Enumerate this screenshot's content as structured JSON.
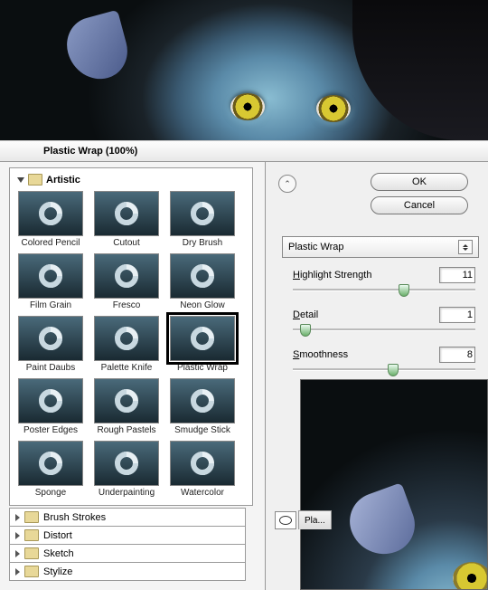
{
  "window": {
    "title": "Plastic Wrap (100%)"
  },
  "buttons": {
    "ok": "OK",
    "cancel": "Cancel"
  },
  "filter_select": {
    "value": "Plastic Wrap"
  },
  "sliders": {
    "highlight": {
      "label": "Highlight Strength",
      "value": "11",
      "pos": 58
    },
    "detail": {
      "label": "Detail",
      "value": "1",
      "pos": 4
    },
    "smoothness": {
      "label": "Smoothness",
      "value": "8",
      "pos": 52
    }
  },
  "category_open": "Artistic",
  "thumbs": [
    "Colored Pencil",
    "Cutout",
    "Dry Brush",
    "Film Grain",
    "Fresco",
    "Neon Glow",
    "Paint Daubs",
    "Palette Knife",
    "Plastic Wrap",
    "Poster Edges",
    "Rough Pastels",
    "Smudge Stick",
    "Sponge",
    "Underpainting",
    "Watercolor"
  ],
  "selected_thumb": "Plastic Wrap",
  "categories": [
    "Brush Strokes",
    "Distort",
    "Sketch",
    "Stylize"
  ],
  "footer_tab": "Pla..."
}
